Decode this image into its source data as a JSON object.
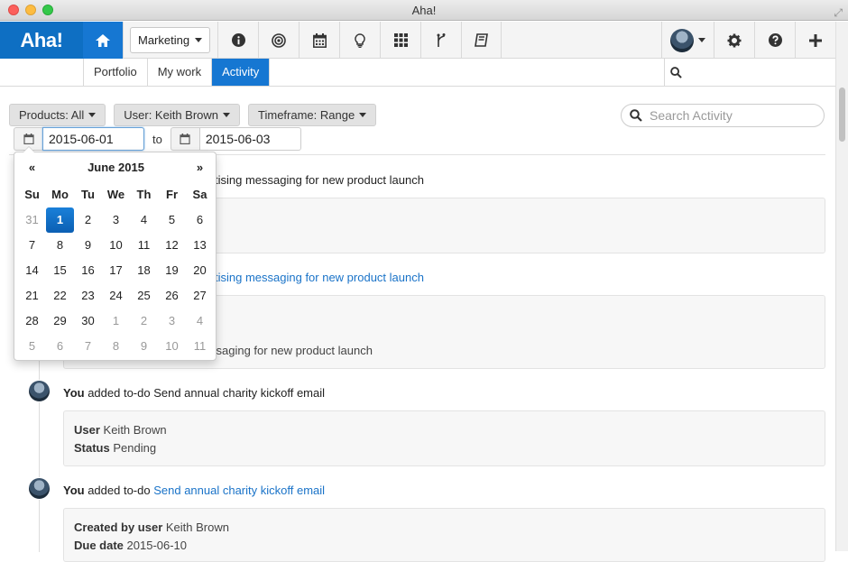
{
  "window": {
    "title": "Aha!"
  },
  "nav": {
    "logo": "Aha!",
    "workspace": "Marketing",
    "icons": [
      "home-icon",
      "info-icon",
      "target-icon",
      "calendar-icon",
      "lightbulb-icon",
      "grid-icon",
      "branch-icon",
      "book-icon"
    ],
    "right_icons": [
      "gear-icon",
      "help-icon",
      "plus-icon"
    ]
  },
  "subnav": {
    "tabs": [
      "Portfolio",
      "My work",
      "Activity"
    ],
    "active": "Activity"
  },
  "filters": {
    "products": "Products: All",
    "user": "User: Keith Brown",
    "timeframe": "Timeframe: Range",
    "search_placeholder": "Search Activity"
  },
  "daterange": {
    "from": "2015-06-01",
    "to_label": "to",
    "to": "2015-06-03"
  },
  "datepicker": {
    "prev": "«",
    "month": "June 2015",
    "next": "»",
    "dow": [
      "Su",
      "Mo",
      "Tu",
      "We",
      "Th",
      "Fr",
      "Sa"
    ],
    "weeks": [
      [
        "31",
        "1",
        "2",
        "3",
        "4",
        "5",
        "6"
      ],
      [
        "7",
        "8",
        "9",
        "10",
        "11",
        "12",
        "13"
      ],
      [
        "14",
        "15",
        "16",
        "17",
        "18",
        "19",
        "20"
      ],
      [
        "21",
        "22",
        "23",
        "24",
        "25",
        "26",
        "27"
      ],
      [
        "28",
        "29",
        "30",
        "1",
        "2",
        "3",
        "4"
      ],
      [
        "5",
        "6",
        "7",
        "8",
        "9",
        "10",
        "11"
      ]
    ]
  },
  "feed": {
    "e1_text": "tising messaging for new product launch",
    "e2_link": "tising messaging for new product launch",
    "e2_card_text": "ssaging for new product launch",
    "e3_you": "You",
    "e3_action": " added to-do Send annual charity kickoff email",
    "e3_user_label": "User",
    "e3_user": " Keith Brown",
    "e3_status_label": "Status",
    "e3_status": " Pending",
    "e4_you": "You",
    "e4_action": " added to-do ",
    "e4_link": "Send annual charity kickoff email",
    "e4_created_label": "Created by user",
    "e4_created": " Keith Brown",
    "e4_due_label": "Due date",
    "e4_due": " 2015-06-10"
  }
}
